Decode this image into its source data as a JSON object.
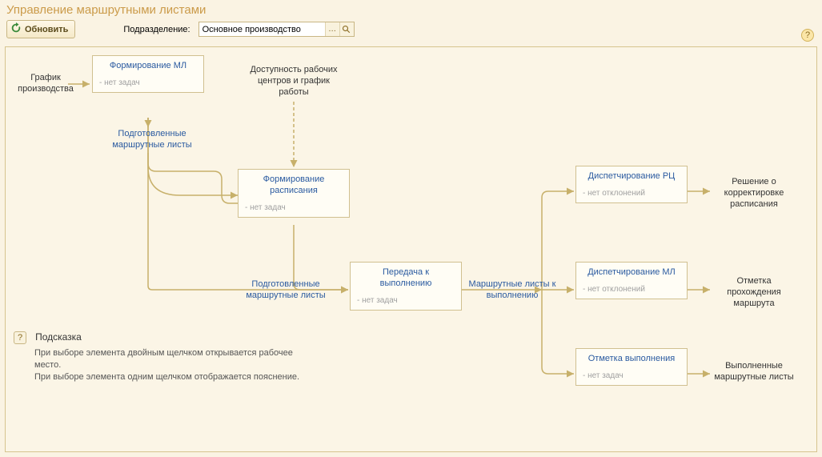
{
  "title": "Управление маршрутными листами",
  "toolbar": {
    "refresh_label": "Обновить",
    "department_label": "Подразделение:",
    "department_value": "Основное производство"
  },
  "nodes": {
    "form_ml": {
      "title": "Формирование МЛ",
      "sub": "- нет задач"
    },
    "form_sched": {
      "title": "Формирование расписания",
      "sub": "- нет задач"
    },
    "transfer": {
      "title": "Передача к выполнению",
      "sub": "- нет задач"
    },
    "disp_rc": {
      "title": "Диспетчирование РЦ",
      "sub": "- нет отклонений"
    },
    "disp_ml": {
      "title": "Диспетчирование МЛ",
      "sub": "- нет отклонений"
    },
    "mark_exec": {
      "title": "Отметка выполнения",
      "sub": "- нет задач"
    }
  },
  "labels": {
    "input_graph": "График производства",
    "avail_centers": "Доступность рабочих центров и график работы",
    "prepared_ml_1": "Подготовленные маршрутные листы",
    "prepared_ml_2": "Подготовленные маршрутные листы",
    "ml_to_exec": "Маршрутные листы к выполнению",
    "decision_corr": "Решение о корректировке расписания",
    "mark_route": "Отметка прохождения маршрута",
    "done_ml": "Выполненные маршрутные листы"
  },
  "hint": {
    "title": "Подсказка",
    "line1": "При выборе элемента двойным щелчком открывается рабочее место.",
    "line2": "При выборе элемента одним щелчком отображается пояснение."
  },
  "chart_data": {
    "type": "flow",
    "nodes": [
      {
        "id": "input_graph",
        "label": "График производства",
        "kind": "input"
      },
      {
        "id": "form_ml",
        "label": "Формирование МЛ",
        "status": "- нет задач",
        "kind": "process"
      },
      {
        "id": "avail_centers",
        "label": "Доступность рабочих центров и график работы",
        "kind": "input"
      },
      {
        "id": "form_sched",
        "label": "Формирование расписания",
        "status": "- нет задач",
        "kind": "process"
      },
      {
        "id": "transfer",
        "label": "Передача к выполнению",
        "status": "- нет задач",
        "kind": "process"
      },
      {
        "id": "disp_rc",
        "label": "Диспетчирование РЦ",
        "status": "- нет отклонений",
        "kind": "process"
      },
      {
        "id": "disp_ml",
        "label": "Диспетчирование МЛ",
        "status": "- нет отклонений",
        "kind": "process"
      },
      {
        "id": "mark_exec",
        "label": "Отметка выполнения",
        "status": "- нет задач",
        "kind": "process"
      },
      {
        "id": "decision_corr",
        "label": "Решение о корректировке расписания",
        "kind": "output"
      },
      {
        "id": "mark_route",
        "label": "Отметка прохождения маршрута",
        "kind": "output"
      },
      {
        "id": "done_ml",
        "label": "Выполненные маршрутные листы",
        "kind": "output"
      }
    ],
    "edges": [
      {
        "from": "input_graph",
        "to": "form_ml"
      },
      {
        "from": "form_ml",
        "to": "form_sched",
        "label": "Подготовленные маршрутные листы"
      },
      {
        "from": "avail_centers",
        "to": "form_sched",
        "style": "dashed"
      },
      {
        "from": "form_ml",
        "to": "transfer",
        "label": "Подготовленные маршрутные листы"
      },
      {
        "from": "form_sched",
        "to": "transfer"
      },
      {
        "from": "transfer",
        "to": "disp_rc",
        "label": "Маршрутные листы к выполнению"
      },
      {
        "from": "transfer",
        "to": "disp_ml",
        "label": "Маршрутные листы к выполнению"
      },
      {
        "from": "transfer",
        "to": "mark_exec",
        "label": "Маршрутные листы к выполнению"
      },
      {
        "from": "disp_rc",
        "to": "decision_corr"
      },
      {
        "from": "disp_ml",
        "to": "mark_route"
      },
      {
        "from": "mark_exec",
        "to": "done_ml"
      }
    ]
  }
}
